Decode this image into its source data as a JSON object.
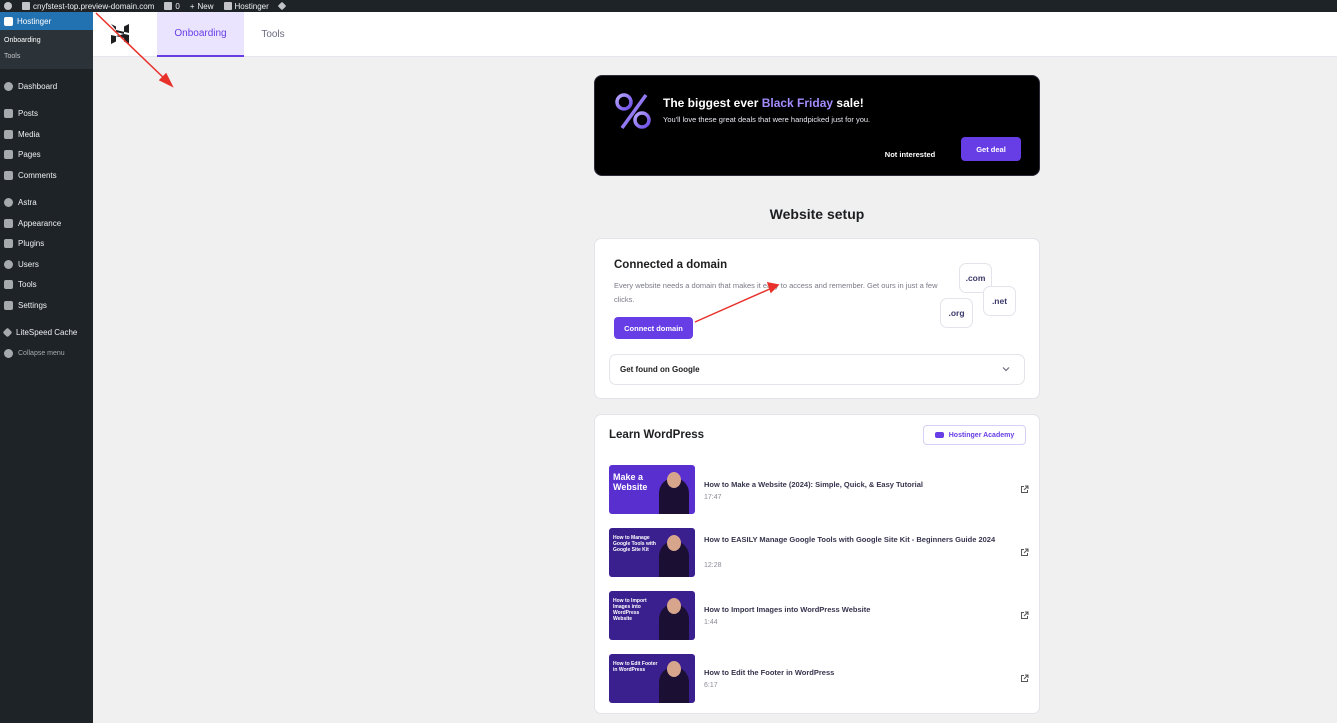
{
  "adminbar": {
    "site": "cnyfstest-top.preview-domain.com",
    "comments_count": "0",
    "new_label": "New",
    "hostinger_label": "Hostinger"
  },
  "sidebar": {
    "top_label": "Hostinger",
    "sub_items": [
      "Onboarding",
      "Tools"
    ],
    "items": [
      {
        "label": "Dashboard",
        "icon": "dashboard-icon"
      },
      {
        "label": "Posts",
        "icon": "pin-icon"
      },
      {
        "label": "Media",
        "icon": "media-icon"
      },
      {
        "label": "Pages",
        "icon": "pages-icon"
      },
      {
        "label": "Comments",
        "icon": "comments-icon"
      },
      {
        "label": "Astra",
        "icon": "astra-icon"
      },
      {
        "label": "Appearance",
        "icon": "brush-icon"
      },
      {
        "label": "Plugins",
        "icon": "plug-icon"
      },
      {
        "label": "Users",
        "icon": "user-icon"
      },
      {
        "label": "Tools",
        "icon": "wrench-icon"
      },
      {
        "label": "Settings",
        "icon": "settings-icon"
      },
      {
        "label": "LiteSpeed Cache",
        "icon": "diamond-icon"
      },
      {
        "label": "Collapse menu",
        "icon": "collapse-icon"
      }
    ]
  },
  "topnav": {
    "tabs": [
      "Onboarding",
      "Tools"
    ]
  },
  "promo": {
    "title_before": "The biggest ever ",
    "title_highlight": "Black Friday",
    "title_after": " sale!",
    "subtitle": "You'll love these great deals that were handpicked just for you.",
    "dismiss_label": "Not interested",
    "cta_label": "Get deal"
  },
  "setup": {
    "title": "Website setup"
  },
  "domain_card": {
    "title": "Connected a domain",
    "text": "Every website needs a domain that makes it easy to access and remember. Get ours in just a few clicks.",
    "button": "Connect domain",
    "tlds": [
      ".com",
      ".net",
      ".org"
    ],
    "accordion": "Get found on Google"
  },
  "learn": {
    "title": "Learn WordPress",
    "academy_button": "Hostinger Academy",
    "videos": [
      {
        "title": "How to Make a Website (2024): Simple, Quick, & Easy Tutorial",
        "duration": "17:47",
        "thumb_text": "Make a Website"
      },
      {
        "title": "How to EASILY Manage Google Tools with Google Site Kit - Beginners Guide 2024",
        "duration": "12:28",
        "thumb_text": "How to Manage Google Tools with Google Site Kit"
      },
      {
        "title": "How to Import Images into WordPress Website",
        "duration": "1:44",
        "thumb_text": "How to Import Images into WordPress Website"
      },
      {
        "title": "How to Edit the Footer in WordPress",
        "duration": "6:17",
        "thumb_text": "How to Edit Footer in WordPress"
      }
    ]
  },
  "colors": {
    "accent": "#673de6",
    "admin_dark": "#1d2327",
    "admin_blue": "#2271b1",
    "annotation": "#e8312b"
  }
}
